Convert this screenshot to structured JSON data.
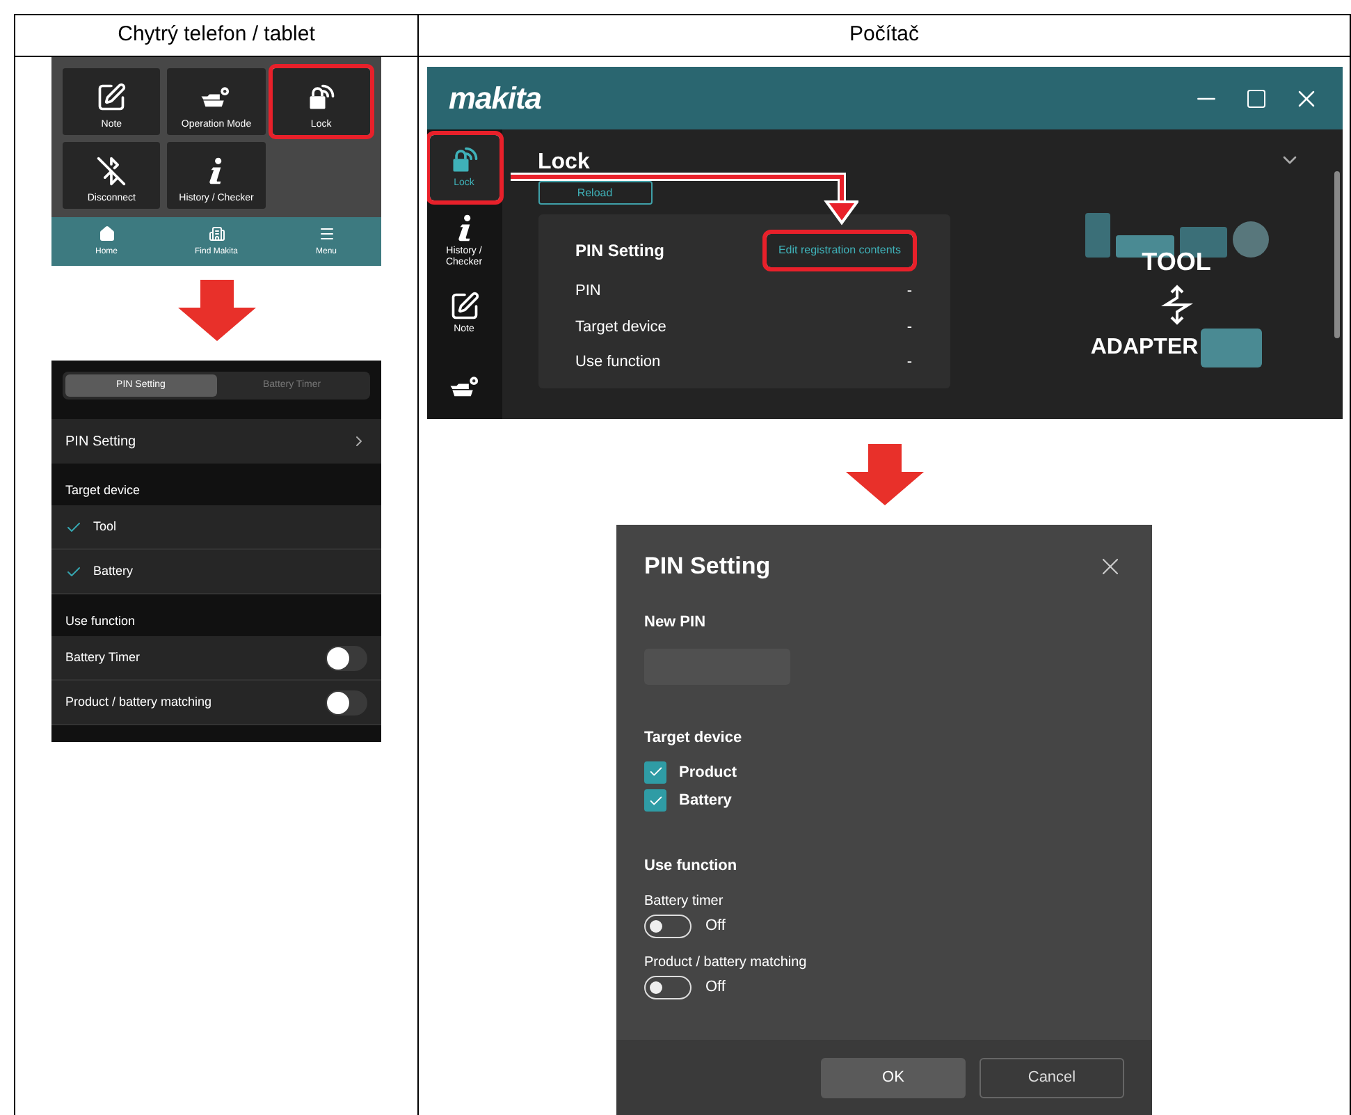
{
  "table": {
    "columns": [
      "Chytrý telefon / tablet",
      "Počítač"
    ]
  },
  "phone_home": {
    "tiles": [
      {
        "label": "Note",
        "kind": "note",
        "highlighted": false
      },
      {
        "label": "Operation Mode",
        "kind": "operation",
        "highlighted": false
      },
      {
        "label": "Lock",
        "kind": "lock",
        "highlighted": true
      },
      {
        "label": "Disconnect",
        "kind": "disconnect",
        "highlighted": false
      },
      {
        "label": "History / Checker",
        "kind": "info",
        "highlighted": false
      }
    ],
    "nav": [
      {
        "label": "Home",
        "kind": "home"
      },
      {
        "label": "Find Makita",
        "kind": "building"
      },
      {
        "label": "Menu",
        "kind": "menu"
      }
    ]
  },
  "phone_lock": {
    "tabs": [
      {
        "label": "PIN Setting",
        "selected": true
      },
      {
        "label": "Battery Timer",
        "selected": false
      }
    ],
    "pin_row": "PIN Setting",
    "sections": [
      {
        "title": "Target device",
        "items": [
          {
            "kind": "check",
            "label": "Tool",
            "checked": true
          },
          {
            "kind": "check",
            "label": "Battery",
            "checked": true
          }
        ]
      },
      {
        "title": "Use function",
        "items": [
          {
            "kind": "toggle",
            "label": "Battery Timer",
            "on": false
          },
          {
            "kind": "toggle",
            "label": "Product / battery matching",
            "on": false
          }
        ]
      }
    ]
  },
  "pc_window": {
    "logo": "makita",
    "nav": [
      {
        "label": "Lock",
        "kind": "lock",
        "selected": true,
        "highlighted": true
      },
      {
        "label": "History / Checker",
        "kind": "info",
        "selected": false,
        "highlighted": false
      },
      {
        "label": "Note",
        "kind": "note",
        "selected": false,
        "highlighted": false
      },
      {
        "kind": "operation",
        "selected": false,
        "highlighted": false
      }
    ],
    "title": "Lock",
    "reload": "Reload",
    "card": {
      "title": "PIN Setting",
      "edit": "Edit registration contents",
      "edit_highlighted": true,
      "rows": [
        {
          "label": "PIN",
          "value": "-"
        },
        {
          "label": "Target device",
          "value": "-"
        },
        {
          "label": "Use function",
          "value": "-"
        }
      ]
    },
    "promo": {
      "top": "TOOL",
      "bottom": "ADAPTER"
    }
  },
  "dialog": {
    "title": "PIN Setting",
    "new_pin_label": "New PIN",
    "target_label": "Target device",
    "targets": [
      {
        "label": "Product",
        "checked": true
      },
      {
        "label": "Battery",
        "checked": true
      }
    ],
    "use_label": "Use function",
    "functions": [
      {
        "label": "Battery timer",
        "on": false,
        "state_text": "Off"
      },
      {
        "label": "Product / battery matching",
        "on": false,
        "state_text": "Off"
      }
    ],
    "buttons": [
      {
        "label": "OK",
        "kind": "primary"
      },
      {
        "label": "Cancel",
        "kind": "secondary"
      }
    ]
  }
}
